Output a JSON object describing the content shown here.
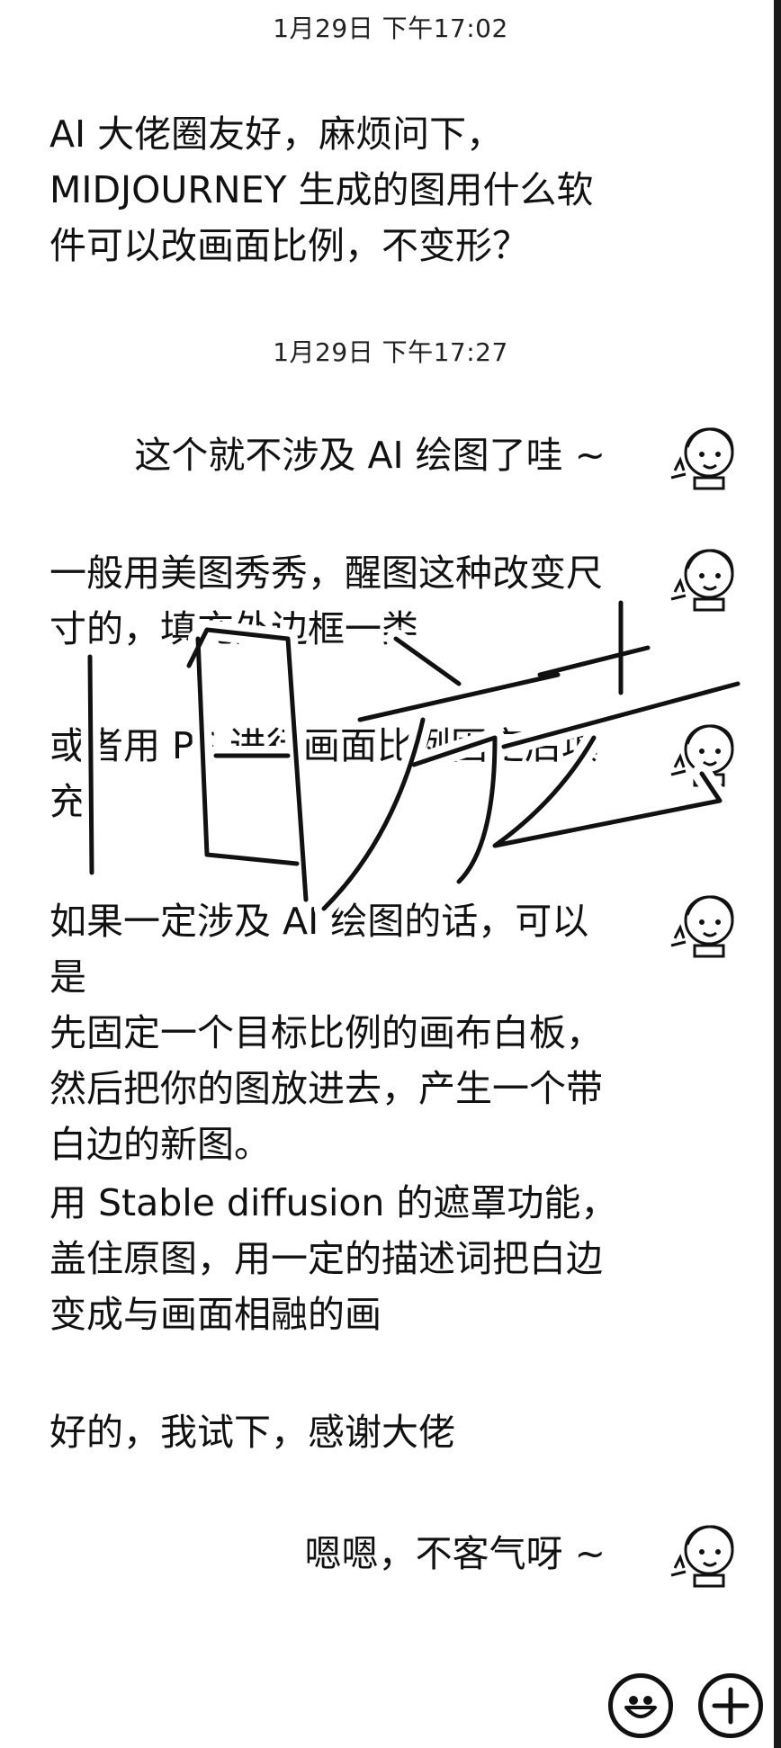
{
  "timestamps": [
    "1月29日 下午17:02",
    "1月29日 下午17:27"
  ],
  "messages": [
    {
      "side": "left",
      "text": "AI 大佬圈友好，麻烦问下，\nMIDJOURNEY 生成的图用什么软\n件可以改画面比例，不变形？"
    },
    {
      "side": "right",
      "text": "这个就不涉及 AI 绘图了哇 ~"
    },
    {
      "side": "left",
      "text": "一般用美图秀秀，醒图这种改变尺\n寸的，填充外边框一类"
    },
    {
      "side": "left",
      "text": "或者用 PS 进行画面比例固定后填\n充"
    },
    {
      "side": "left",
      "text": "如果一定涉及 AI 绘图的话，可以是\n先固定一个目标比例的画布白板，\n然后把你的图放进去，产生一个带\n白边的新图。"
    },
    {
      "side": "left",
      "text": "用 Stable diffusion 的遮罩功能，\n盖住原图，用一定的描述词把白边\n变成与画面相融的画"
    },
    {
      "side": "left",
      "text": "好的，我试下，感谢大佬"
    },
    {
      "side": "right",
      "text": "嗯嗯，不客气呀 ~"
    }
  ],
  "watermark": {
    "text": "旧秀去"
  },
  "icons": {
    "avatar": "cartoon-avatar-icon",
    "emoji": "smile-emoji-icon",
    "add": "plus-circle-icon"
  },
  "colors": {
    "background": "#ffffff",
    "text": "#111111"
  }
}
